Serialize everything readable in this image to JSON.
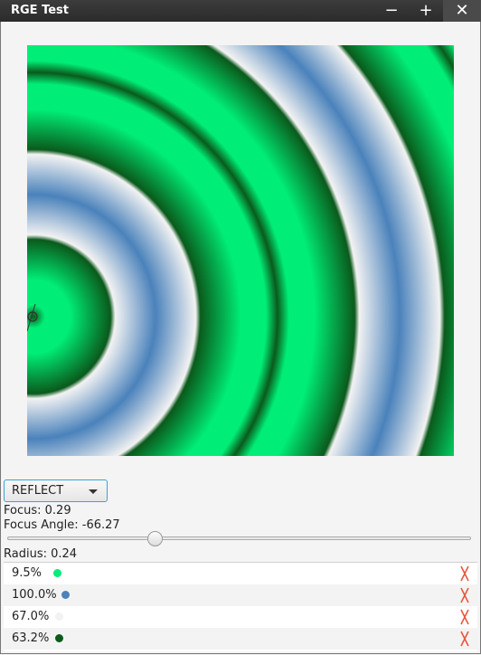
{
  "window": {
    "title": "RGE Test",
    "minimize_glyph": "−",
    "maximize_glyph": "+",
    "close_glyph": "✕"
  },
  "gradient": {
    "cycle_method": "REFLECT",
    "focus_label": "Focus: 0.29",
    "focus_angle_label": "Focus Angle: -66.27",
    "radius_label": "Radius: 0.24",
    "focus_angle_slider": 0.31
  },
  "stops": [
    {
      "percent": "9.5%",
      "color": "#00ee77"
    },
    {
      "percent": "100.0%",
      "color": "#4a82bb"
    },
    {
      "percent": "67.0%",
      "color": "#f2f2f2"
    },
    {
      "percent": "63.2%",
      "color": "#0a5a1c"
    }
  ],
  "colors": {
    "delete_mark": "#e8573c",
    "focus_border": "#39a3d6"
  }
}
